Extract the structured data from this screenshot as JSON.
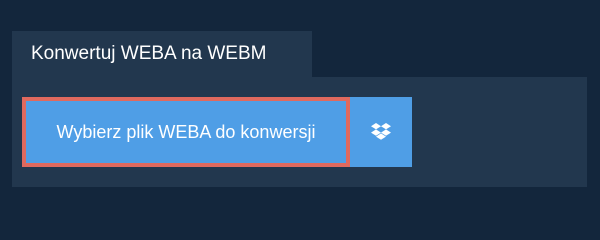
{
  "tab": {
    "title": "Konwertuj WEBA na WEBM"
  },
  "upload": {
    "choose_file_label": "Wybierz plik WEBA do konwersji",
    "dropbox_icon": "dropbox-icon"
  },
  "colors": {
    "page_background": "#13263c",
    "panel_background": "#22374e",
    "button_blue": "#4f9ee6",
    "focus_outline": "#e0695e"
  }
}
